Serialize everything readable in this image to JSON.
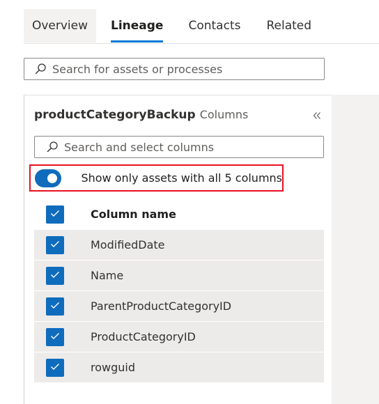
{
  "tabs": [
    {
      "label": "Overview",
      "state": "hovered"
    },
    {
      "label": "Lineage",
      "state": "active"
    },
    {
      "label": "Contacts",
      "state": "default"
    },
    {
      "label": "Related",
      "state": "default"
    }
  ],
  "asset_search": {
    "placeholder": "Search for assets or processes",
    "icon": "search-icon"
  },
  "panel": {
    "title": "productCategoryBackup",
    "subtitle": "Columns",
    "collapse_icon": "double-chevron-left-icon",
    "column_search": {
      "placeholder": "Search and select columns",
      "icon": "search-icon"
    },
    "filter_toggle": {
      "label": "Show only assets with all 5 columns",
      "on": true,
      "highlight_color": "#e81123"
    }
  },
  "column_table": {
    "header": "Column name",
    "header_checked": true,
    "rows": [
      {
        "name": "ModifiedDate",
        "checked": true
      },
      {
        "name": "Name",
        "checked": true
      },
      {
        "name": "ParentProductCategoryID",
        "checked": true
      },
      {
        "name": "ProductCategoryID",
        "checked": true
      },
      {
        "name": "rowguid",
        "checked": true
      }
    ]
  },
  "colors": {
    "accent": "#0078d4",
    "checkbox": "#0f6cbd",
    "row_background": "#edebe9",
    "canvas_background": "#f3f2f1"
  }
}
